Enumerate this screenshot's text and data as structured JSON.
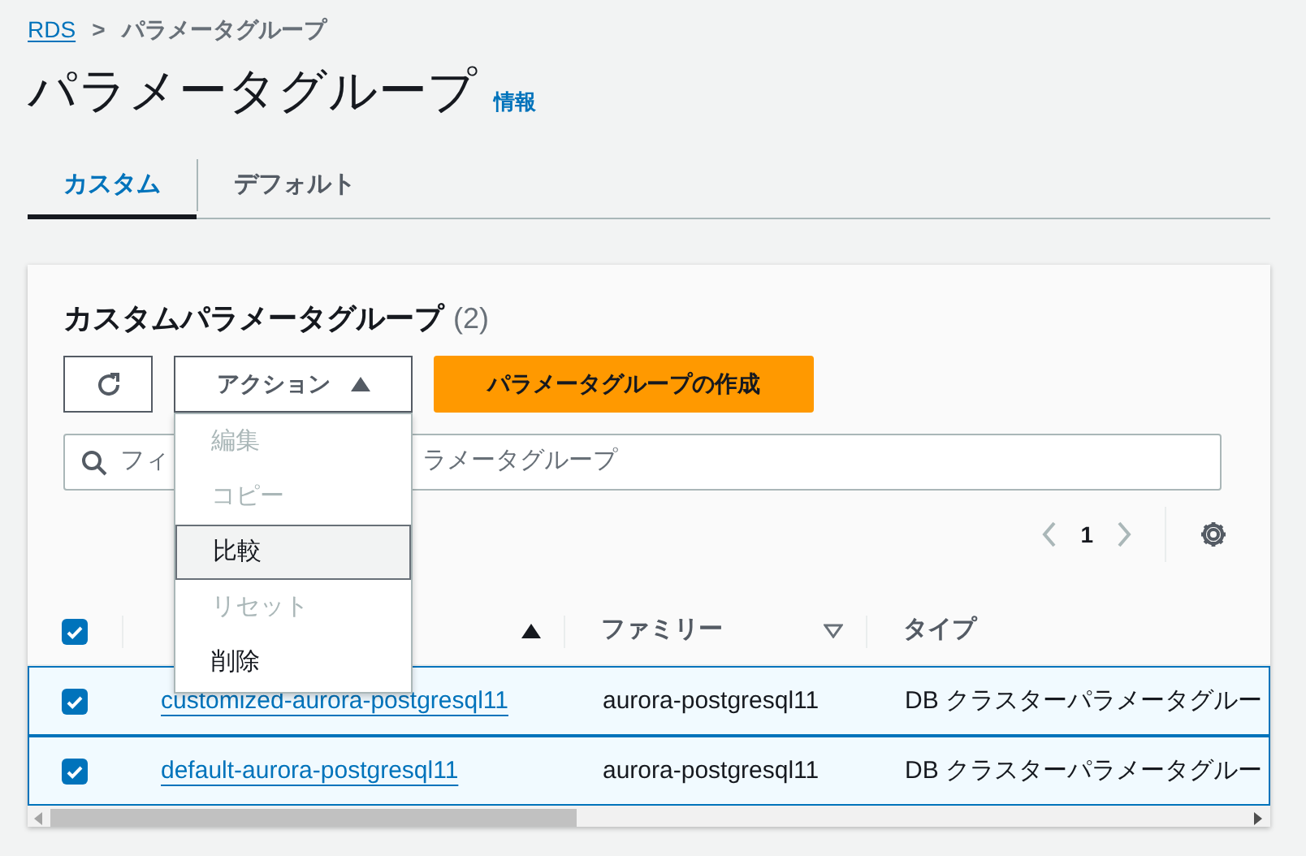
{
  "breadcrumb": {
    "link": "RDS",
    "separator": ">",
    "current": "パラメータグループ"
  },
  "title": "パラメータグループ",
  "info_link": "情報",
  "tabs": [
    {
      "label": "カスタム",
      "selected": true
    },
    {
      "label": "デフォルト",
      "selected": false
    }
  ],
  "panel": {
    "title": "カスタムパラメータグループ",
    "count": "(2)",
    "actions_button": {
      "label": "アクション",
      "expanded": true
    },
    "create_button": "パラメータグループの作成",
    "search": {
      "placeholder_start": "フィ",
      "placeholder_end": "ラメータグループ"
    },
    "pagination": {
      "page": "1"
    },
    "actions_menu": [
      {
        "label": "編集",
        "disabled": true,
        "selected": false
      },
      {
        "label": "コピー",
        "disabled": true,
        "selected": false
      },
      {
        "label": "比較",
        "disabled": false,
        "selected": true
      },
      {
        "label": "リセット",
        "disabled": true,
        "selected": false
      },
      {
        "label": "削除",
        "disabled": false,
        "selected": false
      }
    ]
  },
  "table": {
    "select_all": {
      "checked": true
    },
    "columns": [
      {
        "sorted": true
      },
      {
        "label": "ファミリー",
        "sorted": false
      },
      {
        "label": "タイプ"
      }
    ],
    "rows": [
      {
        "checked": true,
        "selected": true,
        "name": "customized-aurora-postgresql11",
        "family": "aurora-postgresql11",
        "type": "DB クラスターパラメータグルー"
      },
      {
        "checked": true,
        "selected": true,
        "name": "default-aurora-postgresql11",
        "family": "aurora-postgresql11",
        "type": "DB クラスターパラメータグルー"
      }
    ]
  }
}
